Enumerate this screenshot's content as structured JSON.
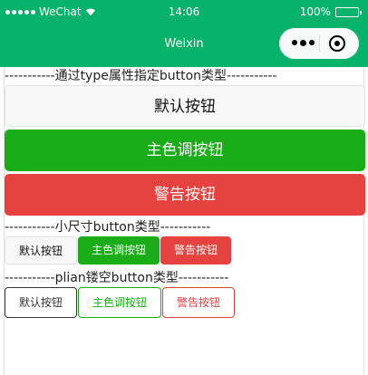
{
  "status_bar": {
    "carrier": "WeChat",
    "time": "14:06",
    "battery": "100%"
  },
  "nav": {
    "title": "Weixin"
  },
  "sections": {
    "type_title": "-----------通过type属性指定button类型-----------",
    "mini_title": "-----------小尺寸button类型-----------",
    "plain_title": "-----------plian镂空button类型-----------"
  },
  "buttons": {
    "default": "默认按钮",
    "primary": "主色调按钮",
    "warn": "警告按钮"
  },
  "colors": {
    "nav_bg": "#07b36b",
    "primary": "#1aad19",
    "warn": "#e64340",
    "default_bg": "#f8f8f8"
  }
}
